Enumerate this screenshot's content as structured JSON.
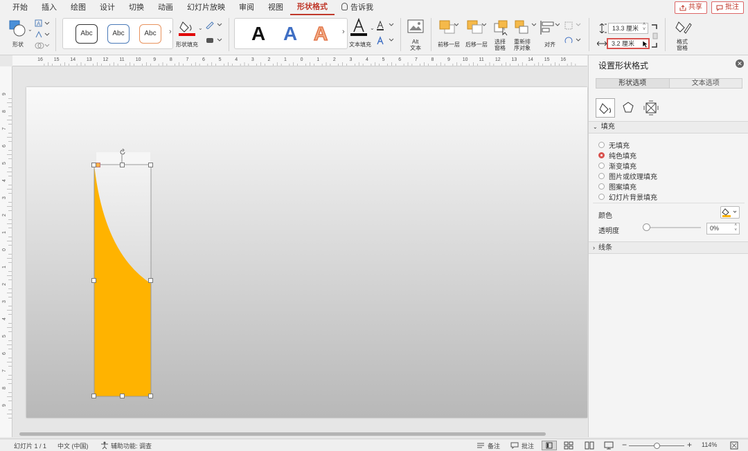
{
  "tabs": [
    "开始",
    "插入",
    "绘图",
    "设计",
    "切换",
    "动画",
    "幻灯片放映",
    "审阅",
    "视图",
    "形状格式"
  ],
  "active_tab": "形状格式",
  "tell_me": "告诉我",
  "share_label": "共享",
  "comment_label": "批注",
  "ribbon": {
    "shape_label": "形状",
    "style_abc": "Abc",
    "shape_fill_label": "形状填充",
    "wordart_letter": "A",
    "text_fill_label": "文本填充",
    "alt_text_label_1": "Alt",
    "alt_text_label_2": "文本",
    "bring_forward_label": "前移一层",
    "send_backward_label": "后移一层",
    "selection_pane_label_1": "选择",
    "selection_pane_label_2": "窗格",
    "reorder_label_1": "重新排",
    "reorder_label_2": "序对象",
    "align_label": "对齐",
    "height_value": "13.3 厘米",
    "width_value": "3.2 厘米",
    "format_pane_label_1": "格式",
    "format_pane_label_2": "窗格",
    "accent_color": "#c0392b",
    "fill_color_bar": "#e00000"
  },
  "ruler": {
    "h_labels": [
      "16",
      "15",
      "14",
      "13",
      "12",
      "11",
      "10",
      "9",
      "8",
      "7",
      "6",
      "5",
      "4",
      "3",
      "2",
      "1",
      "0",
      "1",
      "2",
      "3",
      "4",
      "5",
      "6",
      "7",
      "8",
      "9",
      "10",
      "11",
      "12",
      "13",
      "14",
      "15",
      "16"
    ],
    "v_labels": [
      "9",
      "8",
      "7",
      "6",
      "5",
      "4",
      "3",
      "2",
      "1",
      "0",
      "1",
      "2",
      "3",
      "4",
      "5",
      "6",
      "7",
      "8",
      "9"
    ]
  },
  "shape": {
    "fill_color": "#ffb300"
  },
  "pane": {
    "title": "设置形状格式",
    "tab_shape": "形状选项",
    "tab_text": "文本选项",
    "fill_section": "填充",
    "fill_options": [
      "无填充",
      "纯色填充",
      "渐变填充",
      "图片或纹理填充",
      "图案填充",
      "幻灯片背景填充"
    ],
    "selected_fill": "纯色填充",
    "color_label": "颜色",
    "transparency_label": "透明度",
    "transparency_value": "0%",
    "line_section": "线条"
  },
  "status": {
    "slide_info": "幻灯片 1 / 1",
    "language": "中文 (中国)",
    "accessibility": "辅助功能: 调查",
    "notes_label": "备注",
    "comments_label": "批注",
    "zoom": "114%"
  }
}
